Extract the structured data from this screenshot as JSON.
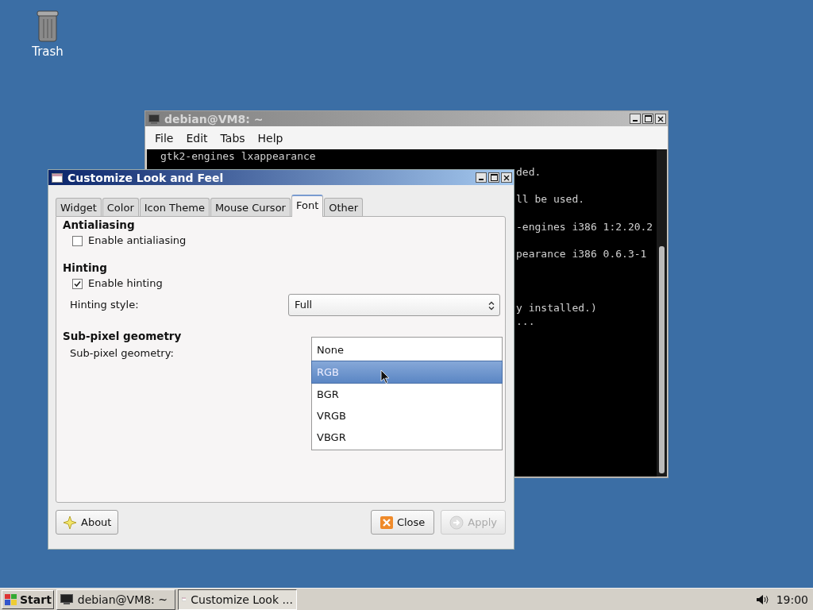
{
  "desktop": {
    "icons": [
      {
        "label": "Trash"
      }
    ]
  },
  "terminal": {
    "title": "debian@VM8: ~",
    "menu": [
      "File",
      "Edit",
      "Tabs",
      "Help"
    ],
    "first_line": "gtk2-engines lxappearance",
    "fragments": [
      "ded.",
      "ll be used.",
      "-engines i386 1:2.20.2",
      "pearance i386 0.6.3-1",
      "y installed.)",
      "..."
    ]
  },
  "dialog": {
    "title": "Customize Look and Feel",
    "tabs": [
      {
        "label": "Widget",
        "selected": false
      },
      {
        "label": "Color",
        "selected": false
      },
      {
        "label": "Icon Theme",
        "selected": false
      },
      {
        "label": "Mouse Cursor",
        "selected": false
      },
      {
        "label": "Font",
        "selected": true
      },
      {
        "label": "Other",
        "selected": false
      }
    ],
    "sections": [
      {
        "heading": "Antialiasing",
        "rows": [
          {
            "kind": "checkbox",
            "label": "Enable antialiasing",
            "checked": false
          }
        ]
      },
      {
        "heading": "Hinting",
        "rows": [
          {
            "kind": "checkbox",
            "label": "Enable hinting",
            "checked": true
          },
          {
            "kind": "select",
            "label": "Hinting style:",
            "value": "Full"
          }
        ]
      },
      {
        "heading": "Sub-pixel geometry",
        "rows": [
          {
            "kind": "popup",
            "label": "Sub-pixel geometry:",
            "options": [
              {
                "label": "None",
                "selected": false
              },
              {
                "label": "RGB",
                "selected": true
              },
              {
                "label": "BGR",
                "selected": false
              },
              {
                "label": "VRGB",
                "selected": false
              },
              {
                "label": "VBGR",
                "selected": false
              }
            ]
          }
        ]
      }
    ],
    "buttons": [
      {
        "kind": "about",
        "label": "About",
        "disabled": false
      },
      {
        "kind": "close",
        "label": "Close",
        "disabled": false
      },
      {
        "kind": "apply",
        "label": "Apply",
        "disabled": true
      }
    ]
  },
  "taskbar": {
    "start": "Start",
    "tasks": [
      {
        "kind": "terminal",
        "label": "debian@VM8: ~",
        "selected": false
      },
      {
        "kind": "dialog",
        "label": "Customize Look ...",
        "selected": true
      }
    ],
    "clock": "19:00"
  }
}
